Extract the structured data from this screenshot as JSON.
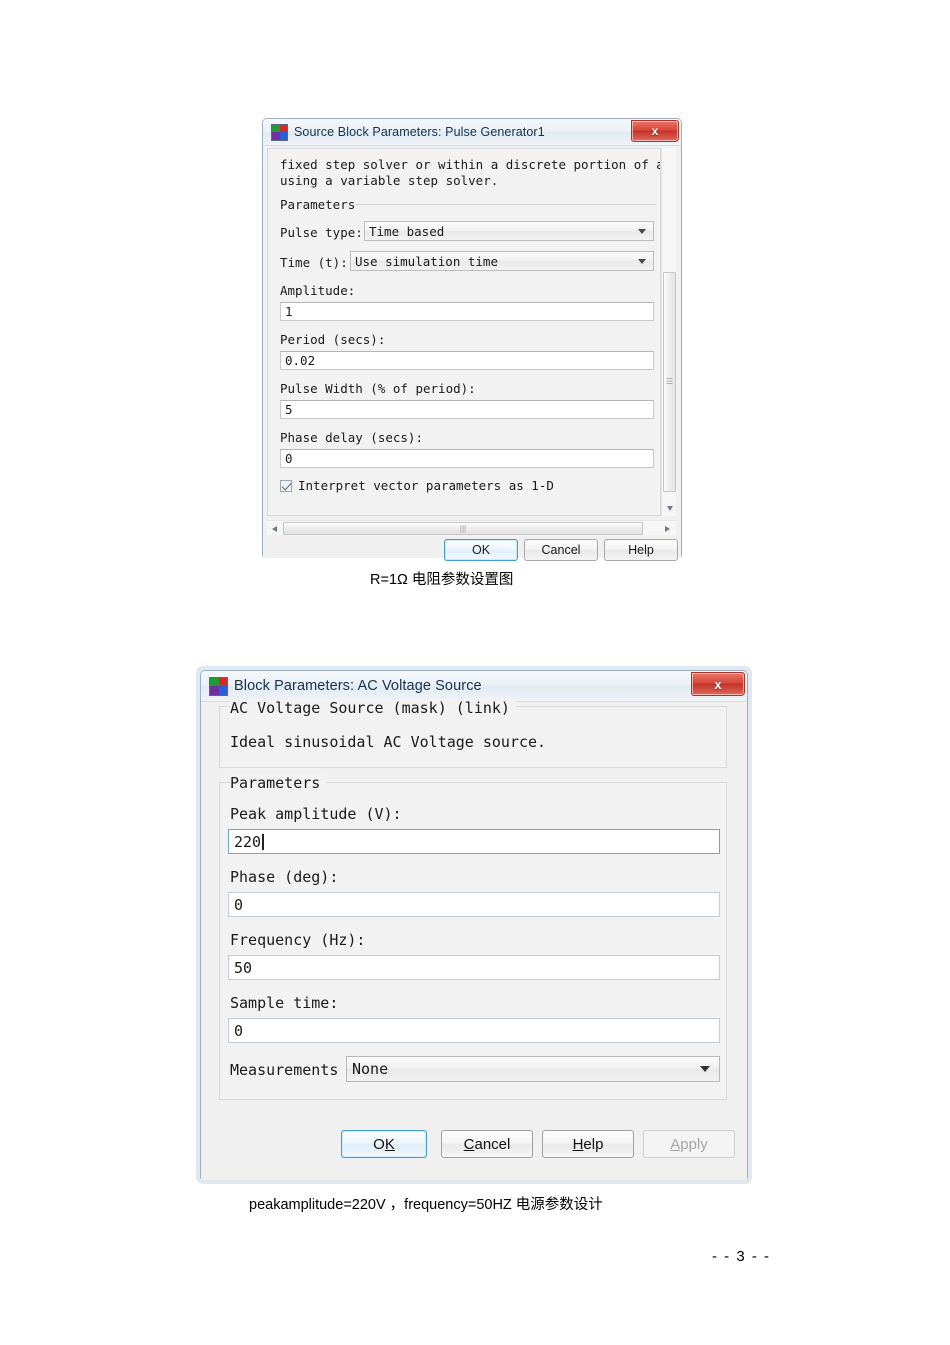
{
  "page": {
    "footer": "- - 3 - -"
  },
  "dialog1": {
    "title": "Source Block Parameters: Pulse Generator1",
    "icon": "simulink-block-icon",
    "close_label": "x",
    "description": "fixed step solver or within a discrete portion of a model\nusing a variable step solver.",
    "group_label": "Parameters",
    "fields": {
      "pulse_type_label": "Pulse type:",
      "pulse_type_value": "Time based",
      "time_label": "Time (t):",
      "time_value": "Use simulation time",
      "amplitude_label": "Amplitude:",
      "amplitude_value": "1",
      "period_label": "Period (secs):",
      "period_value": "0.02",
      "pulse_width_label": "Pulse Width (% of period):",
      "pulse_width_value": "5",
      "phase_delay_label": "Phase delay (secs):",
      "phase_delay_value": "0",
      "interpret_label": "Interpret vector parameters as 1-D",
      "interpret_checked": true
    },
    "buttons": {
      "ok": "OK",
      "cancel": "Cancel",
      "help": "Help"
    }
  },
  "caption1": "R=1Ω 电阻参数设置图",
  "dialog2": {
    "title": "Block Parameters: AC Voltage Source",
    "icon": "simulink-block-icon",
    "close_label": "x",
    "mask_header": "AC Voltage Source (mask) (link)",
    "mask_description": "Ideal sinusoidal AC Voltage source.",
    "group_label": "Parameters",
    "fields": {
      "peak_amplitude_label": "Peak amplitude (V):",
      "peak_amplitude_value": "220",
      "phase_label": "Phase (deg):",
      "phase_value": "0",
      "frequency_label": "Frequency (Hz):",
      "frequency_value": "50",
      "sample_time_label": "Sample time:",
      "sample_time_value": "0",
      "measurements_label": "Measurements",
      "measurements_value": "None"
    },
    "buttons": {
      "ok_pre": "O",
      "ok_mn": "K",
      "ok_post": "",
      "cancel_pre": "",
      "cancel_mn": "C",
      "cancel_post": "ancel",
      "help_pre": "",
      "help_mn": "H",
      "help_post": "elp",
      "apply_pre": "",
      "apply_mn": "A",
      "apply_post": "pply"
    }
  },
  "caption2": "peakamplitude=220V ，frequency=50HZ  电源参数设计",
  "colors": {
    "accent": "#3f9ad6",
    "close_red": "#c43226",
    "dialog_bg": "#f0f0f0"
  }
}
